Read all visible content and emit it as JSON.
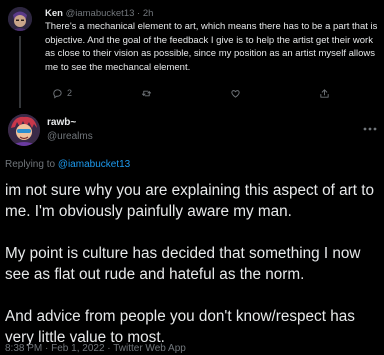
{
  "parent_tweet": {
    "author_name": "Ken",
    "author_handle": "@iamabucket13",
    "separator": "·",
    "time": "2h",
    "text": "There's a mechanical element to art, which means there has to be a part that is objective. And the goal of the feedback I give is to help the artist get their work as close to their vision as possible, since my position as an artist myself allows me to see the mechancal element.",
    "actions": {
      "reply_icon": "comment-icon",
      "reply_count": "2",
      "retweet_icon": "retweet-icon",
      "like_icon": "heart-icon",
      "share_icon": "share-icon"
    }
  },
  "reply_tweet": {
    "author_name": "rawb~",
    "author_handle": "@urealms",
    "more_icon": "more-icon",
    "replying_prefix": "Replying to",
    "replying_to": "@iamabucket13",
    "paragraphs": [
      "im not sure why you are explaining this aspect of art to me. I'm obviously painfully aware my man.",
      "My point is culture has decided that something I now see as flat out rude and hateful as the norm.",
      "And advice from people you don't know/respect has very little value to most."
    ],
    "timestamp": "8:38 PM · Feb 1, 2022 · Twitter Web App"
  },
  "colors": {
    "background": "#000000",
    "text_primary": "#e7e9ea",
    "text_muted": "#71767b",
    "link": "#1d9bf0"
  }
}
